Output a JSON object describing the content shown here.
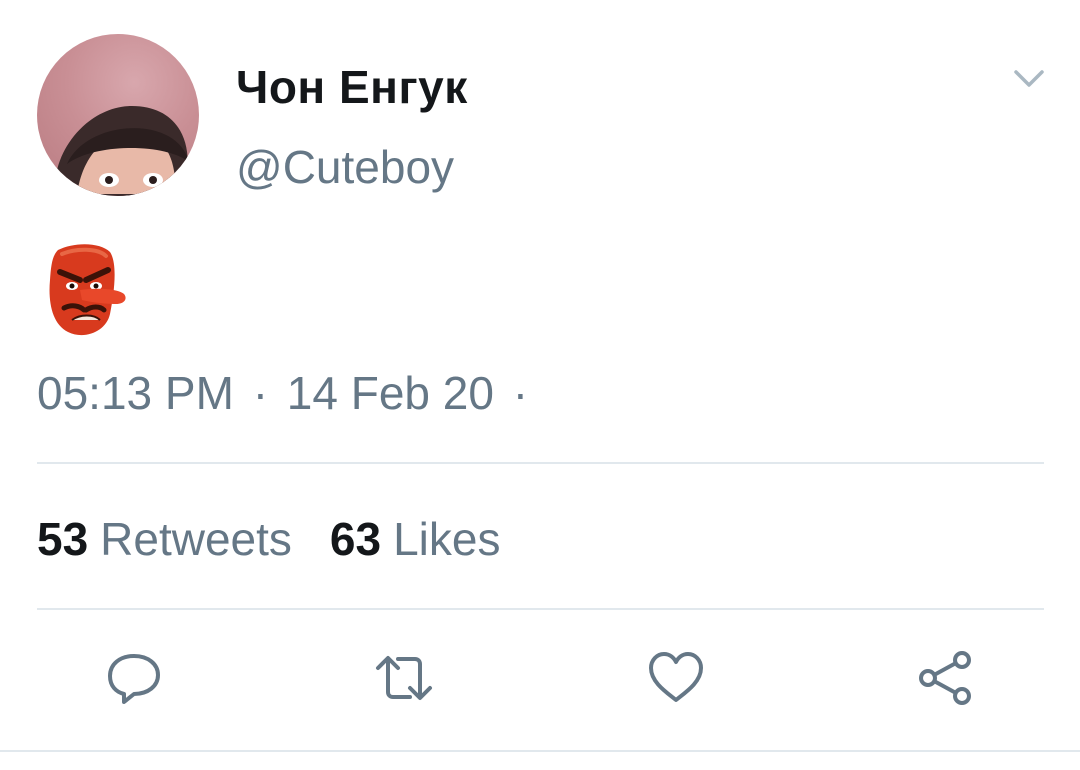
{
  "author": {
    "display_name": "Чон Енгук",
    "handle": "@Cuteboy"
  },
  "tweet": {
    "content_icon": "tengu-emoji",
    "time": "05:13 PM",
    "date": "14 Feb 20",
    "separator": "·"
  },
  "stats": {
    "retweets_count": "53",
    "retweets_label": "Retweets",
    "likes_count": "63",
    "likes_label": "Likes"
  },
  "actions": [
    "reply-icon",
    "retweet-icon",
    "like-icon",
    "share-icon"
  ],
  "colors": {
    "text_primary": "#14171a",
    "text_secondary": "#657786",
    "divider": "#e1e8ed",
    "icon": "#657786"
  }
}
